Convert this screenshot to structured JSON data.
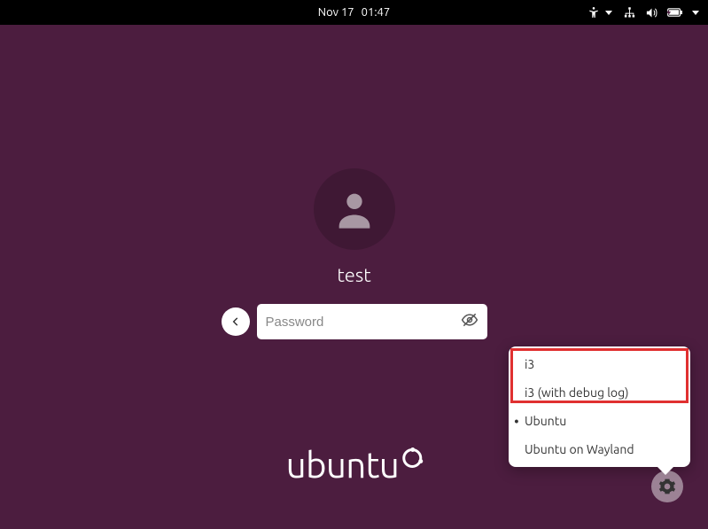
{
  "topbar": {
    "date": "Nov 17",
    "time": "01:47"
  },
  "login": {
    "username": "test",
    "password_placeholder": "Password"
  },
  "logo_text": "ubuntu",
  "session_menu": {
    "items": [
      {
        "label": "i3",
        "selected": false
      },
      {
        "label": "i3 (with debug log)",
        "selected": false
      },
      {
        "label": "Ubuntu",
        "selected": true
      },
      {
        "label": "Ubuntu on Wayland",
        "selected": false
      }
    ]
  }
}
